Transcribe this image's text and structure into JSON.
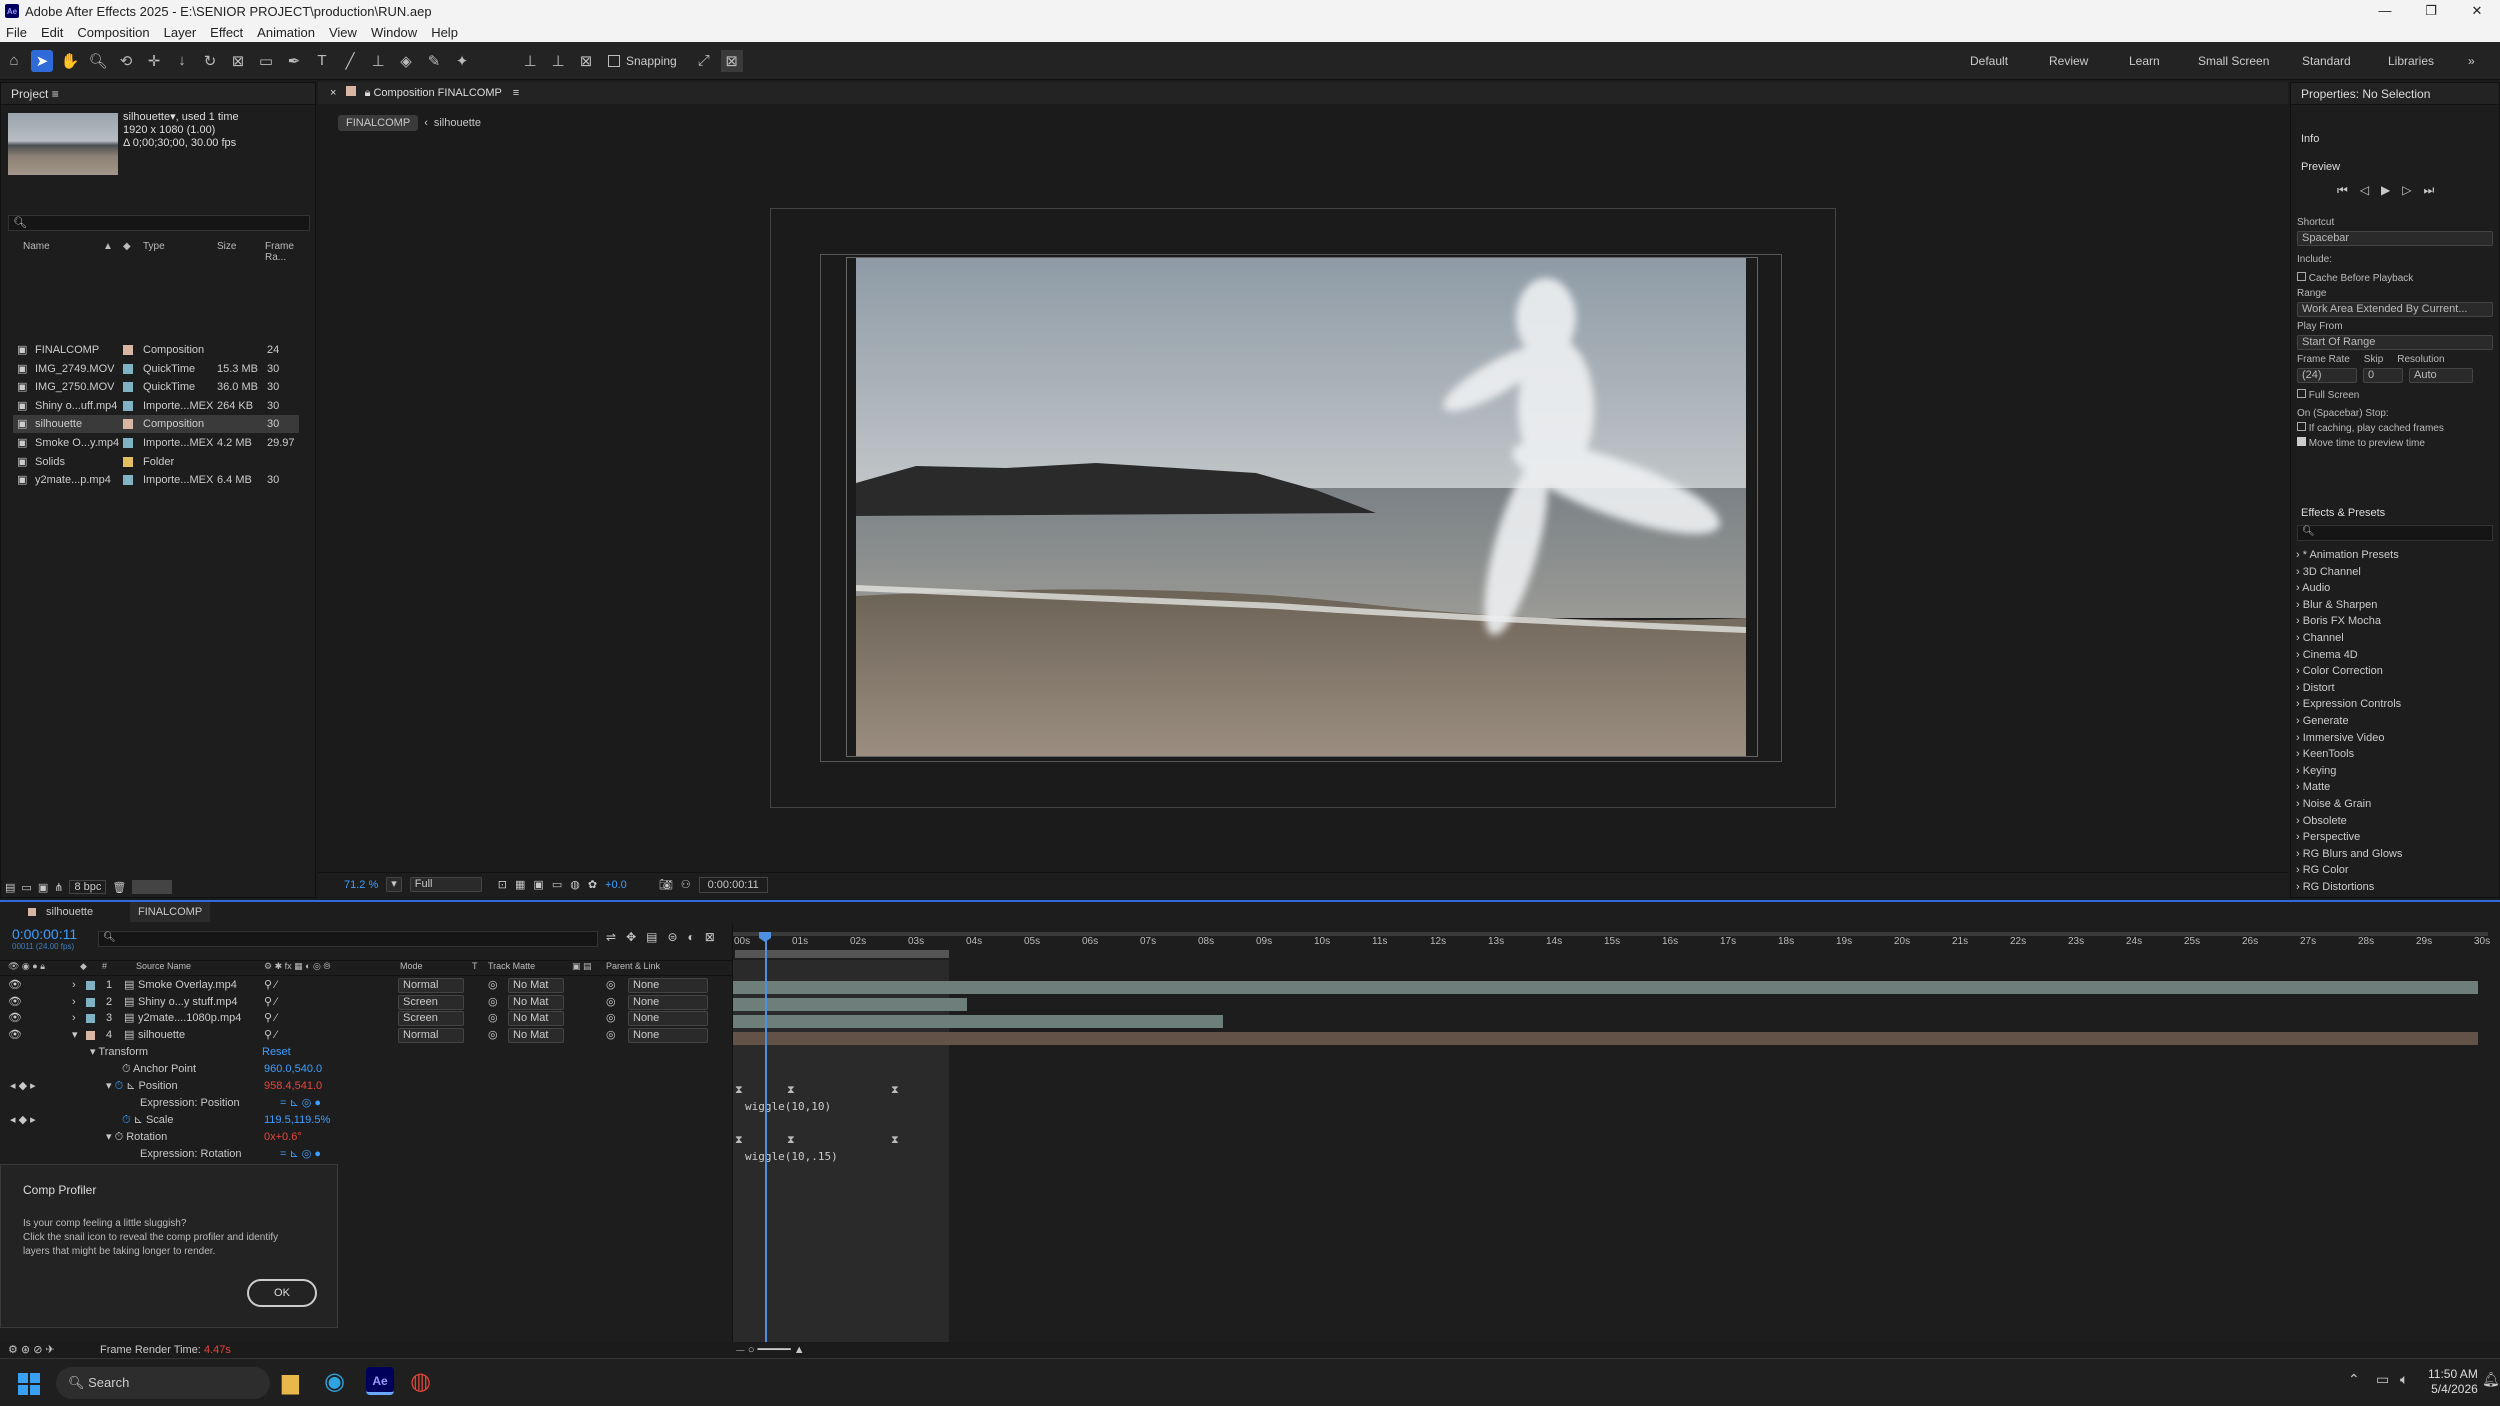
{
  "window": {
    "title": "Adobe After Effects 2025 - E:\\SENIOR PROJECT\\production\\RUN.aep",
    "controls": [
      "—",
      "❐",
      "✕"
    ]
  },
  "menu": [
    "File",
    "Edit",
    "Composition",
    "Layer",
    "Effect",
    "Animation",
    "View",
    "Window",
    "Help"
  ],
  "toolbar": {
    "snapping_label": "Snapping"
  },
  "workspaces": [
    "Default",
    "Review",
    "Learn",
    "Small Screen",
    "Standard",
    "Libraries",
    "»"
  ],
  "project": {
    "title": "Project",
    "selected_name": "silhouette",
    "used": ", used 1 time",
    "dims": "1920 x 1080 (1.00)",
    "duration": "Δ 0;00;30;00, 30.00 fps",
    "search_placeholder": "",
    "columns": [
      "Name",
      "Type",
      "Size",
      "Frame Ra..."
    ],
    "items": [
      {
        "name": "FINALCOMP",
        "type": "Composition",
        "size": "",
        "fps": "24",
        "color": "#d9b6a4"
      },
      {
        "name": "IMG_2749.MOV",
        "type": "QuickTime",
        "size": "15.3 MB",
        "fps": "30",
        "color": "#7fb3c4"
      },
      {
        "name": "IMG_2750.MOV",
        "type": "QuickTime",
        "size": "36.0 MB",
        "fps": "30",
        "color": "#7fb3c4"
      },
      {
        "name": "Shiny o...uff.mp4",
        "type": "Importe...MEX",
        "size": "264 KB",
        "fps": "30",
        "color": "#7fb3c4"
      },
      {
        "name": "silhouette",
        "type": "Composition",
        "size": "",
        "fps": "30",
        "color": "#d9b6a4"
      },
      {
        "name": "Smoke O...y.mp4",
        "type": "Importe...MEX",
        "size": "4.2 MB",
        "fps": "29.97",
        "color": "#7fb3c4"
      },
      {
        "name": "Solids",
        "type": "Folder",
        "size": "",
        "fps": "",
        "color": "#e0c060"
      },
      {
        "name": "y2mate...p.mp4",
        "type": "Importe...MEX",
        "size": "6.4 MB",
        "fps": "30",
        "color": "#7fb3c4"
      }
    ],
    "bpc": "8 bpc"
  },
  "comp": {
    "tab": "Composition FINALCOMP",
    "crumb1": "FINALCOMP",
    "crumb2": "silhouette",
    "zoom": "71.2 %",
    "quality": "Full",
    "exposure": "+0.0",
    "timecode": "0:00:00:11"
  },
  "properties": {
    "title": "Properties: No Selection",
    "info": "Info",
    "preview": "Preview",
    "shortcut_label": "Shortcut",
    "shortcut": "Spacebar",
    "include": "Include:",
    "cache": "Cache Before Playback",
    "range_label": "Range",
    "range": "Work Area Extended By Current...",
    "playfrom_label": "Play From",
    "playfrom": "Start Of Range",
    "fr_label": "Frame Rate",
    "skip_label": "Skip",
    "res_label": "Resolution",
    "fr": "(24)",
    "skip": "0",
    "res": "Auto",
    "fullscreen": "Full Screen",
    "onstop": "On (Spacebar) Stop:",
    "ifcaching": "If caching, play cached frames",
    "movetime": "Move time to preview time"
  },
  "effects": {
    "title": "Effects & Presets",
    "items": [
      "* Animation Presets",
      "3D Channel",
      "Audio",
      "Blur & Sharpen",
      "Boris FX Mocha",
      "Channel",
      "Cinema 4D",
      "Color Correction",
      "Distort",
      "Expression Controls",
      "Generate",
      "Immersive Video",
      "KeenTools",
      "Keying",
      "Matte",
      "Noise & Grain",
      "Obsolete",
      "Perspective",
      "RG Blurs and Glows",
      "RG Color",
      "RG Distortions"
    ]
  },
  "timeline": {
    "tab1": "silhouette",
    "tab2": "FINALCOMP",
    "timecode": "0:00:00:11",
    "frames": "00011 (24.00 fps)",
    "cols": {
      "source": "Source Name",
      "mode": "Mode",
      "t": "T",
      "matte": "Track Matte",
      "parent": "Parent & Link"
    },
    "layers": [
      {
        "n": "1",
        "name": "Smoke Overlay.mp4",
        "mode": "Normal",
        "matte": "No Mat",
        "parent": "None"
      },
      {
        "n": "2",
        "name": "Shiny o...y stuff.mp4",
        "mode": "Screen",
        "matte": "No Mat",
        "parent": "None"
      },
      {
        "n": "3",
        "name": "y2mate....1080p.mp4",
        "mode": "Screen",
        "matte": "No Mat",
        "parent": "None"
      },
      {
        "n": "4",
        "name": "silhouette",
        "mode": "Normal",
        "matte": "No Mat",
        "parent": "None"
      }
    ],
    "transform": "Transform",
    "reset": "Reset",
    "anchor": "Anchor Point",
    "anchor_val": "960.0,540.0",
    "position": "Position",
    "position_val": "958.4,541.0",
    "expr_pos": "Expression: Position",
    "scale": "Scale",
    "scale_val": "119.5,119.5%",
    "rotation": "Rotation",
    "rotation_val": "0x+0.6°",
    "expr_rot": "Expression: Rotation",
    "code_pos": "wiggle(10,10)",
    "code_rot": "wiggle(10,.15)",
    "ruler": [
      "00s",
      "01s",
      "02s",
      "03s",
      "04s",
      "05s",
      "06s",
      "07s",
      "08s",
      "09s",
      "10s",
      "11s",
      "12s",
      "13s",
      "14s",
      "15s",
      "16s",
      "17s",
      "18s",
      "19s",
      "20s",
      "21s",
      "22s",
      "23s",
      "24s",
      "25s",
      "26s",
      "27s",
      "28s",
      "29s",
      "30s"
    ],
    "render_label": "Frame Render Time:",
    "render_val": "4.47s"
  },
  "profiler": {
    "title": "Comp Profiler",
    "body1": "Is your comp feeling a little sluggish?",
    "body2": "Click the snail icon to reveal the comp profiler and identify",
    "body3": "layers that might be taking longer to render.",
    "ok": "OK"
  },
  "taskbar": {
    "search": "Search",
    "time": "11:50 AM",
    "date": "5/4/2026"
  }
}
